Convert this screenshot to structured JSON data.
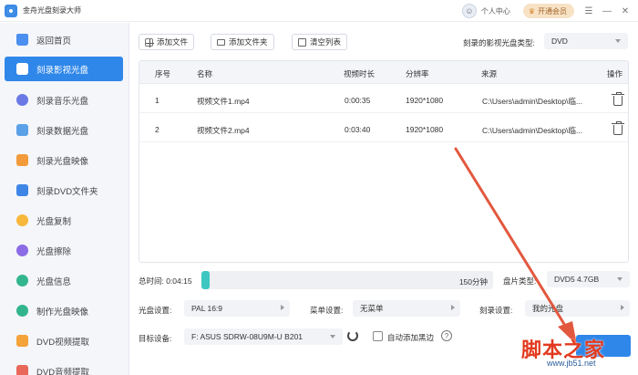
{
  "app": {
    "title": "金舟光盘刻录大师"
  },
  "titlebar": {
    "user_center": "个人中心",
    "vip": "开通会员",
    "menu": "☰",
    "minimize": "—",
    "close": "✕"
  },
  "sidebar": {
    "items": [
      {
        "label": "返回首页",
        "icon": "home-icon"
      },
      {
        "label": "刻录影视光盘",
        "icon": "video-disc-icon"
      },
      {
        "label": "刻录音乐光盘",
        "icon": "music-disc-icon"
      },
      {
        "label": "刻录数据光盘",
        "icon": "data-disc-icon"
      },
      {
        "label": "刻录光盘映像",
        "icon": "image-disc-icon"
      },
      {
        "label": "刻录DVD文件夹",
        "icon": "dvd-folder-icon"
      },
      {
        "label": "光盘复制",
        "icon": "disc-copy-icon"
      },
      {
        "label": "光盘擦除",
        "icon": "disc-erase-icon"
      },
      {
        "label": "光盘信息",
        "icon": "disc-info-icon"
      },
      {
        "label": "制作光盘映像",
        "icon": "make-image-icon"
      },
      {
        "label": "DVD视频提取",
        "icon": "dvd-video-extract-icon"
      },
      {
        "label": "DVD音频提取",
        "icon": "dvd-audio-extract-icon"
      }
    ],
    "active_index": 1
  },
  "toolbar": {
    "add_file": "添加文件",
    "add_folder": "添加文件夹",
    "clear_list": "清空列表"
  },
  "disc_type": {
    "label": "刻录的影视光盘类型:",
    "value": "DVD"
  },
  "table": {
    "headers": {
      "index": "序号",
      "name": "名称",
      "duration": "视频时长",
      "resolution": "分辨率",
      "source": "来源",
      "action": "操作"
    },
    "rows": [
      {
        "index": "1",
        "name": "视频文件1.mp4",
        "duration": "0:00:35",
        "resolution": "1920*1080",
        "source": "C:\\Users\\admin\\Desktop\\临..."
      },
      {
        "index": "2",
        "name": "视频文件2.mp4",
        "duration": "0:03:40",
        "resolution": "1920*1080",
        "source": "C:\\Users\\admin\\Desktop\\临..."
      }
    ]
  },
  "capacity": {
    "total_label": "总时间: 0:04:15",
    "max_label": "150分钟",
    "fill_fraction": 0.028
  },
  "disc_size": {
    "label": "盘片类型:",
    "value": "DVD5 4.7GB"
  },
  "settings": {
    "disc_setting_label": "光盘设置:",
    "disc_setting_value": "PAL 16:9",
    "menu_setting_label": "菜单设置:",
    "menu_setting_value": "无菜单",
    "burn_setting_label": "刻录设置:",
    "burn_setting_value": "我的光盘"
  },
  "target": {
    "label": "目标设备:",
    "value": "F: ASUS SDRW-08U9M-U B201"
  },
  "auto_black": {
    "label": "自动添加黑边"
  },
  "help": "?",
  "watermark": {
    "text": "脚本之家",
    "sub": "www.jb51.net"
  },
  "colors": {
    "accent": "#2f87e9",
    "progress": "#3ec7c1",
    "annotation_arrow": "#e2583e"
  }
}
